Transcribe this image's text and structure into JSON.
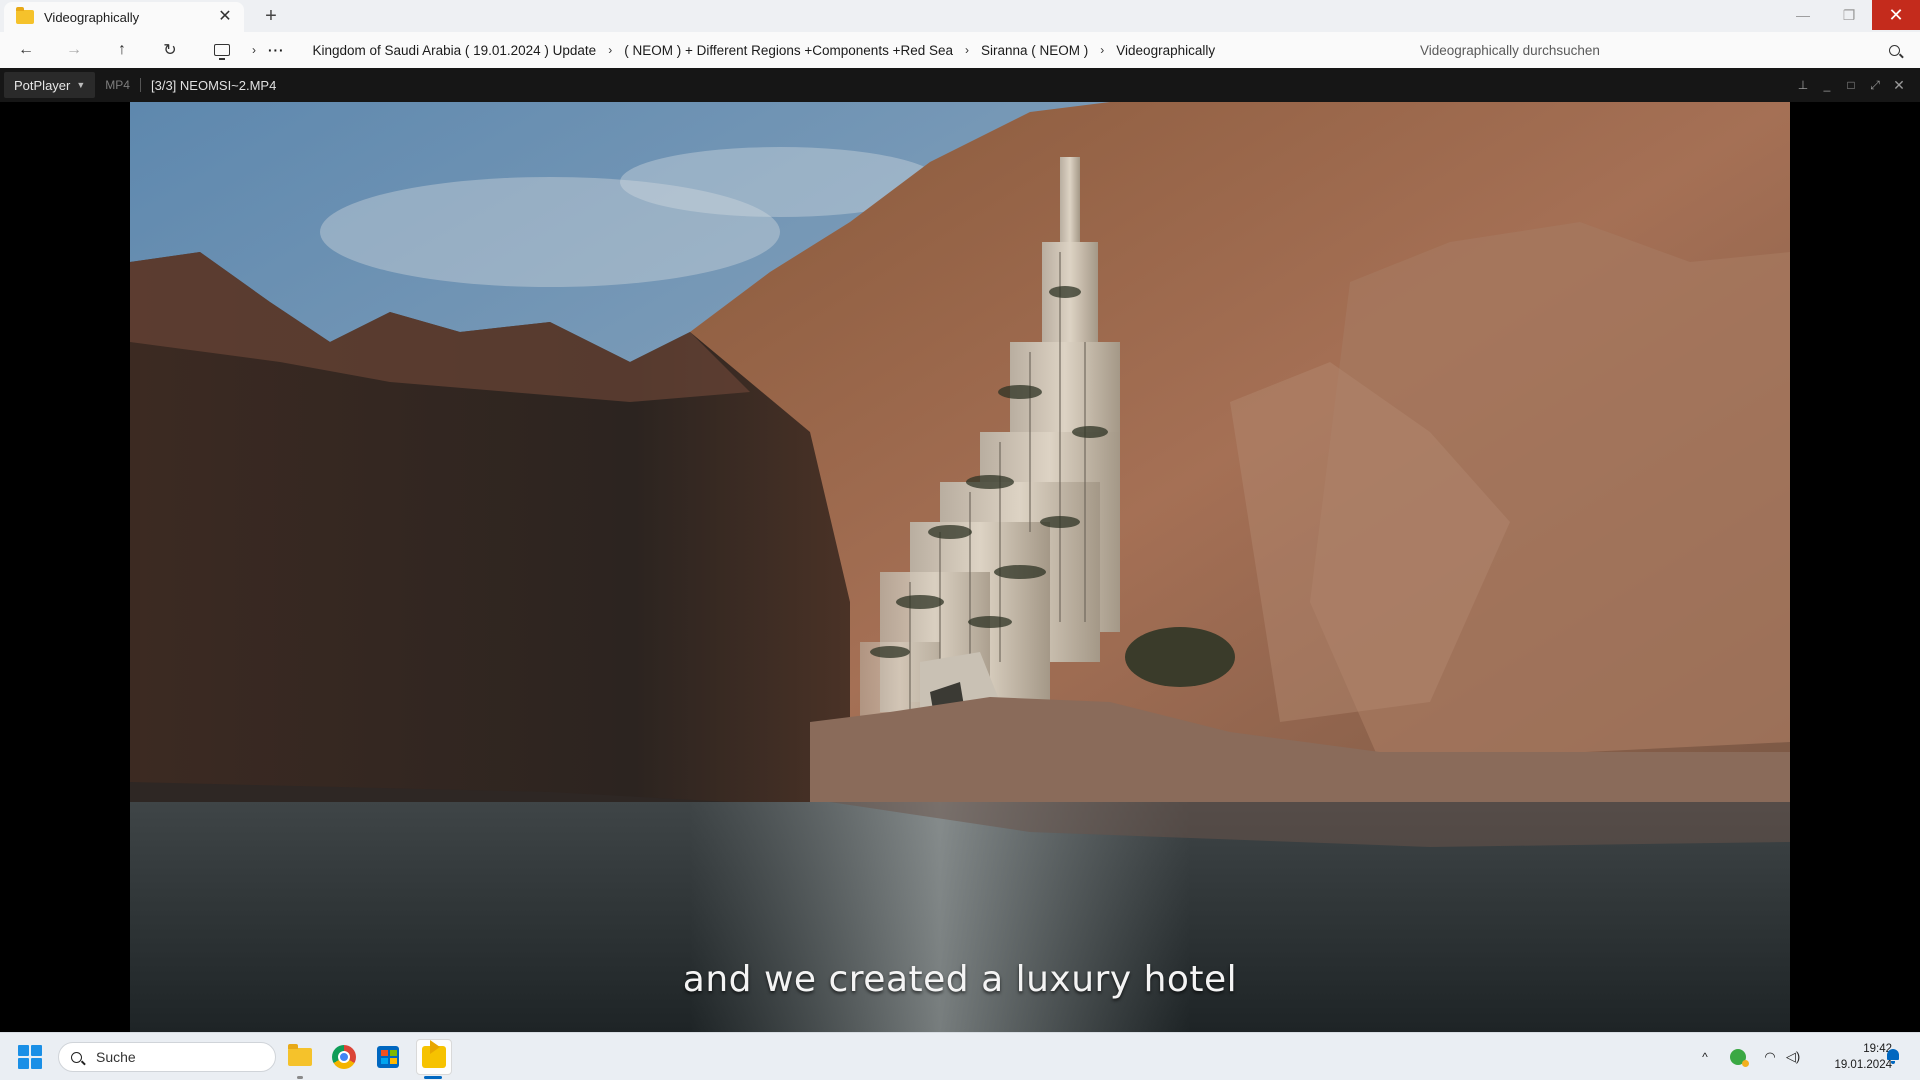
{
  "explorer": {
    "tab_title": "Videographically",
    "tab_close_icon": "close-icon",
    "new_tab_icon": "plus-icon",
    "breadcrumbs": [
      "Kingdom of Saudi Arabia ( 19.01.2024 ) Update",
      "( NEOM ) + Different Regions +Components +Red Sea",
      "Siranna ( NEOM )",
      "Videographically"
    ],
    "search_placeholder": "Videographically durchsuchen"
  },
  "player": {
    "menu_label": "PotPlayer",
    "format": "MP4",
    "file_title": "[3/3] NEOMSI~2.MP4",
    "subtitle": "and we created a luxury hotel"
  },
  "taskbar": {
    "search_label": "Suche",
    "time": "19:42",
    "date": "19.01.2024"
  },
  "colors": {
    "close_red": "#c42b1c",
    "accent_blue": "#0067c0",
    "player_bg": "#000000",
    "player_titlebar": "#161616"
  }
}
